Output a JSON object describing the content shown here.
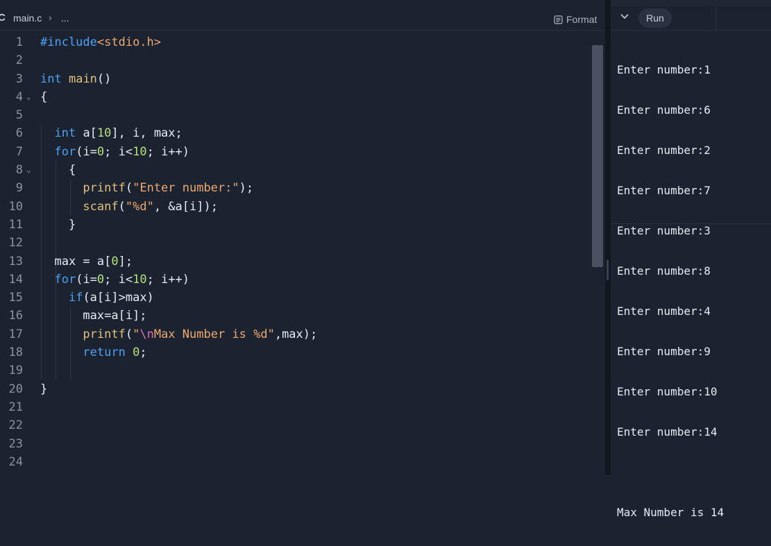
{
  "editor": {
    "file_name": "main.c",
    "breadcrumb_separator": "›",
    "breadcrumb_more": "...",
    "format_label": "Format",
    "line_numbers": [
      "1",
      "2",
      "3",
      "4",
      "5",
      "6",
      "7",
      "8",
      "9",
      "10",
      "11",
      "12",
      "13",
      "14",
      "15",
      "16",
      "17",
      "18",
      "19",
      "20",
      "21",
      "22",
      "23",
      "24"
    ],
    "fold_markers": {
      "4": "⌄",
      "8": "⌄"
    }
  },
  "console": {
    "run_label": "Run",
    "output_lines": [
      "Enter number:1",
      "Enter number:6",
      "Enter number:2",
      "Enter number:7",
      "Enter number:3",
      "Enter number:8",
      "Enter number:4",
      "Enter number:9",
      "Enter number:10",
      "Enter number:14",
      "",
      "Max Number is 14"
    ]
  },
  "colors": {
    "background": "#1b2230",
    "keyword": "#4ea1f3",
    "function": "#e5c07b",
    "string": "#f0a870",
    "number": "#b5e07a",
    "escape": "#e06cb8"
  }
}
